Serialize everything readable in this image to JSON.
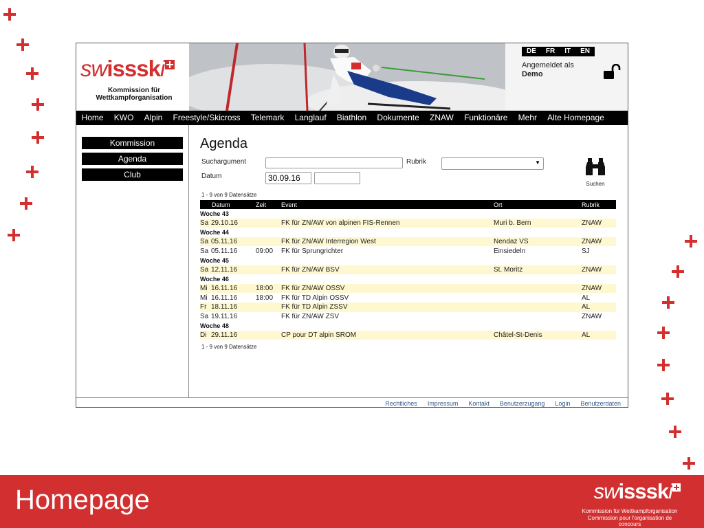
{
  "header": {
    "logo_text": "swissski",
    "logo_sub1": "Kommission für",
    "logo_sub2": "Wettkampforganisation",
    "languages": [
      "DE",
      "FR",
      "IT",
      "EN"
    ],
    "logged_in_label": "Angemeldet als",
    "user": "Demo"
  },
  "nav": [
    "Home",
    "KWO",
    "Alpin",
    "Freestyle/Skicross",
    "Telemark",
    "Langlauf",
    "Biathlon",
    "Dokumente",
    "ZNAW",
    "Funktionäre",
    "Mehr",
    "Alte Homepage"
  ],
  "sidebar": [
    "Kommission",
    "Agenda",
    "Club"
  ],
  "main": {
    "title": "Agenda",
    "search_label": "Suchargument",
    "search_value": "",
    "rubrik_label": "Rubrik",
    "rubrik_value": "",
    "date_label": "Datum",
    "date_from": "30.09.16",
    "date_to": "",
    "search_button": "Suchen",
    "count_top": "1 - 9 von 9 Datensätze",
    "count_bottom": "1 - 9 von 9 Datensätze",
    "columns": [
      "Datum",
      "Zeit",
      "Event",
      "Ort",
      "Rubrik"
    ],
    "rows": [
      {
        "week": "Woche 43"
      },
      {
        "day": "Sa",
        "date": "29.10.16",
        "time": "",
        "event": "FK für ZN/AW von alpinen FIS-Rennen",
        "ort": "Muri b. Bern",
        "rubrik": "ZNAW"
      },
      {
        "week": "Woche 44"
      },
      {
        "day": "Sa",
        "date": "05.11.16",
        "time": "",
        "event": "FK für ZN/AW Interregion West",
        "ort": "Nendaz VS",
        "rubrik": "ZNAW"
      },
      {
        "day": "Sa",
        "date": "05.11.16",
        "time": "09:00",
        "event": "FK für Sprungrichter",
        "ort": "Einsiedeln",
        "rubrik": "SJ"
      },
      {
        "week": "Woche 45"
      },
      {
        "day": "Sa",
        "date": "12.11.16",
        "time": "",
        "event": "FK für ZN/AW BSV",
        "ort": "St. Moritz",
        "rubrik": "ZNAW"
      },
      {
        "week": "Woche 46"
      },
      {
        "day": "Mi",
        "date": "16.11.16",
        "time": "18:00",
        "event": "FK für ZN/AW OSSV",
        "ort": "",
        "rubrik": "ZNAW"
      },
      {
        "day": "Mi",
        "date": "16.11.16",
        "time": "18:00",
        "event": "FK für TD Alpin OSSV",
        "ort": "",
        "rubrik": "AL"
      },
      {
        "day": "Fr",
        "date": "18.11.16",
        "time": "",
        "event": "FK für TD Alpin ZSSV",
        "ort": "",
        "rubrik": "AL"
      },
      {
        "day": "Sa",
        "date": "19.11.16",
        "time": "",
        "event": "FK für ZN/AW ZSV",
        "ort": "",
        "rubrik": "ZNAW"
      },
      {
        "week": "Woche 48"
      },
      {
        "day": "Di",
        "date": "29.11.16",
        "time": "",
        "event": "CP pour DT alpin SROM",
        "ort": "Châtel-St-Denis",
        "rubrik": "AL"
      }
    ]
  },
  "footer": [
    "Rechtliches",
    "Impressum",
    "Kontakt",
    "Benutzerzugang",
    "Login",
    "Benutzerdaten"
  ],
  "banner": {
    "title": "Homepage",
    "brand": "swissski",
    "line1": "Kommission für Wettkampforganisation",
    "line2": "Commission pour l'organisation de concours"
  },
  "colors": {
    "accent": "#d32f2f",
    "row_highlight": "#fdf8d0",
    "nav_bg": "#000000"
  },
  "icons": [
    "cross-icon",
    "lock-icon",
    "binoculars-icon",
    "chevron-down-icon"
  ]
}
